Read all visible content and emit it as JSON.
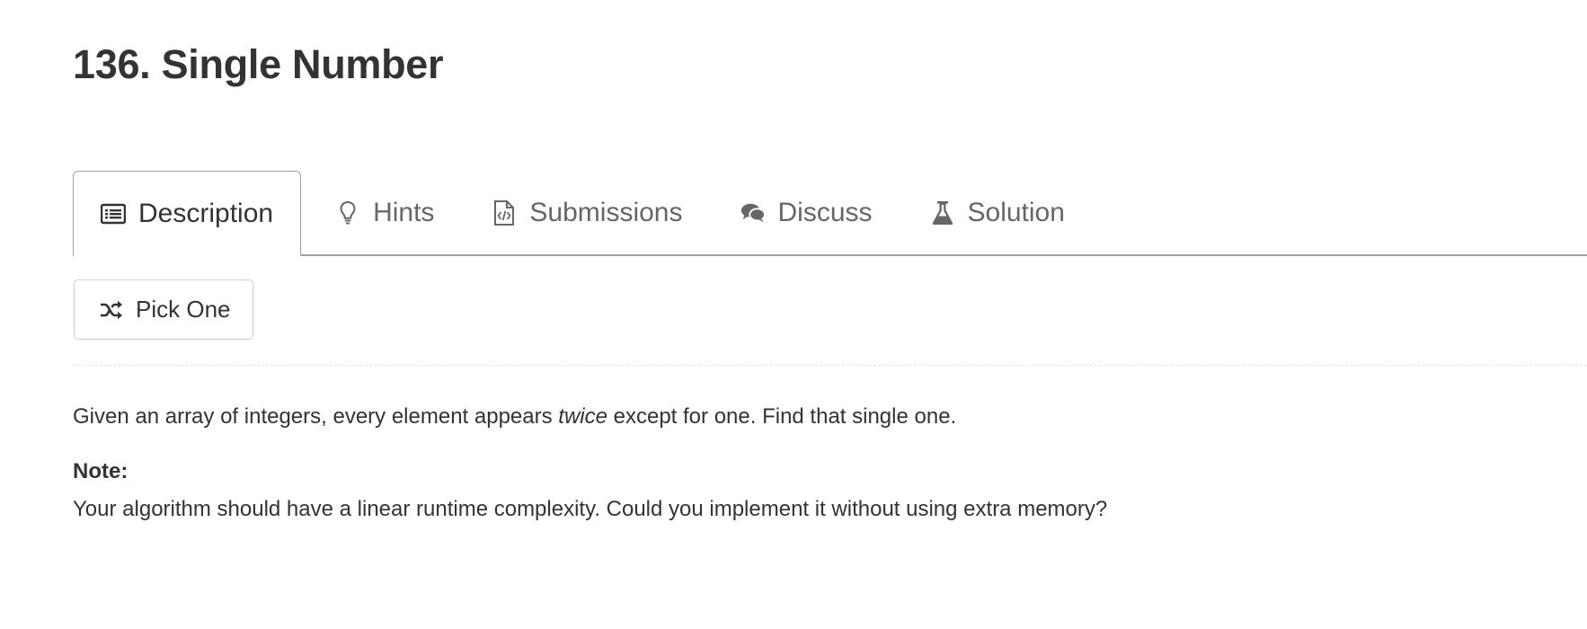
{
  "problem": {
    "title": "136. Single Number"
  },
  "tabs": [
    {
      "label": "Description",
      "icon": "list-icon",
      "active": true
    },
    {
      "label": "Hints",
      "icon": "lightbulb-icon",
      "active": false
    },
    {
      "label": "Submissions",
      "icon": "code-file-icon",
      "active": false
    },
    {
      "label": "Discuss",
      "icon": "comments-icon",
      "active": false
    },
    {
      "label": "Solution",
      "icon": "flask-icon",
      "active": false
    }
  ],
  "pick_button": {
    "label": "Pick One",
    "icon": "shuffle-icon"
  },
  "description": {
    "before_emphasis": "Given an array of integers, every element appears ",
    "emphasis": "twice",
    "after_emphasis": " except for one. Find that single one.",
    "note_label": "Note:",
    "note_text": "Your algorithm should have a linear runtime complexity. Could you implement it without using extra memory?"
  },
  "colors": {
    "text": "#333333",
    "muted_text": "#666666",
    "tab_border": "#a0a0a0",
    "button_border": "#cccccc"
  }
}
